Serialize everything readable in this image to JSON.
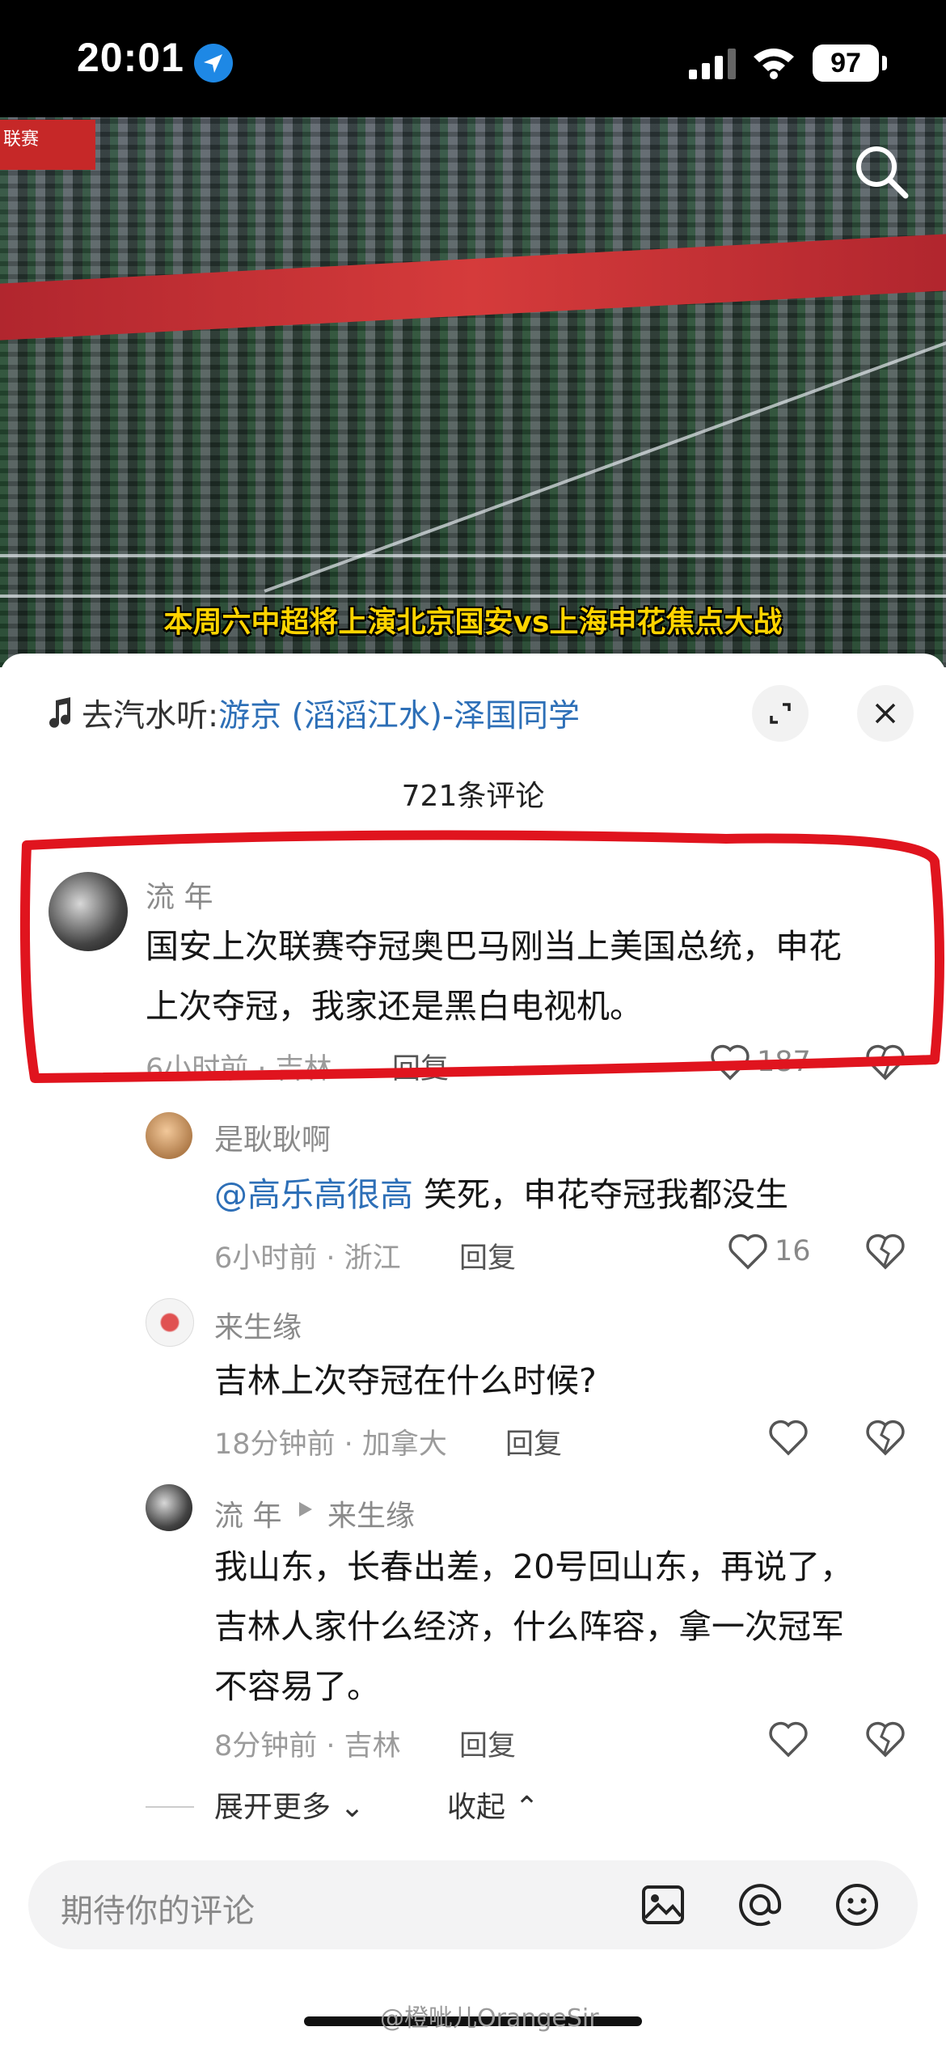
{
  "status_bar": {
    "time": "20:01",
    "battery": "97"
  },
  "video": {
    "league_tag": "联赛",
    "caption": "本周六中超将上演北京国安vs上海申花焦点大战"
  },
  "music": {
    "prefix": "去汽水听:",
    "song": "游京 (滔滔江水)-泽国同学"
  },
  "comments_header": {
    "count_label": "721条评论"
  },
  "comments": [
    {
      "username": "流 年",
      "lines": [
        "国安上次联赛夺冠奥巴马刚当上美国总统，申花",
        "上次夺冠，我家还是黑白电视机。"
      ],
      "meta": "6小时前 · 吉林",
      "reply": "回复",
      "likes": "187"
    },
    {
      "username": "是耿耿啊",
      "mention": "@高乐高很高",
      "text": " 笑死，申花夺冠我都没生",
      "meta": "6小时前 · 浙江",
      "reply": "回复",
      "likes": "16"
    },
    {
      "username": "来生缘",
      "text": "吉林上次夺冠在什么时候?",
      "meta": "18分钟前 · 加拿大",
      "reply": "回复"
    },
    {
      "username": "流 年",
      "reply_to": "来生缘",
      "lines": [
        "我山东，长春出差，20号回山东，再说了，",
        "吉林人家什么经济，什么阵容，拿一次冠军",
        "不容易了。"
      ],
      "meta": "8分钟前 · 吉林",
      "reply": "回复"
    }
  ],
  "expand": {
    "more": "展开更多",
    "collapse": "收起"
  },
  "input": {
    "placeholder": "期待你的评论"
  },
  "watermark": "@橙呲儿OrangeSir",
  "colors": {
    "link": "#2d6fb7",
    "highlight": "#e0141e",
    "caption": "#ffd400"
  },
  "icons": [
    "location-arrow-icon",
    "signal-icon",
    "wifi-icon",
    "search-icon",
    "music-note-icon",
    "expand-icon",
    "close-icon",
    "heart-icon",
    "broken-heart-icon",
    "image-icon",
    "at-icon",
    "emoji-icon"
  ]
}
